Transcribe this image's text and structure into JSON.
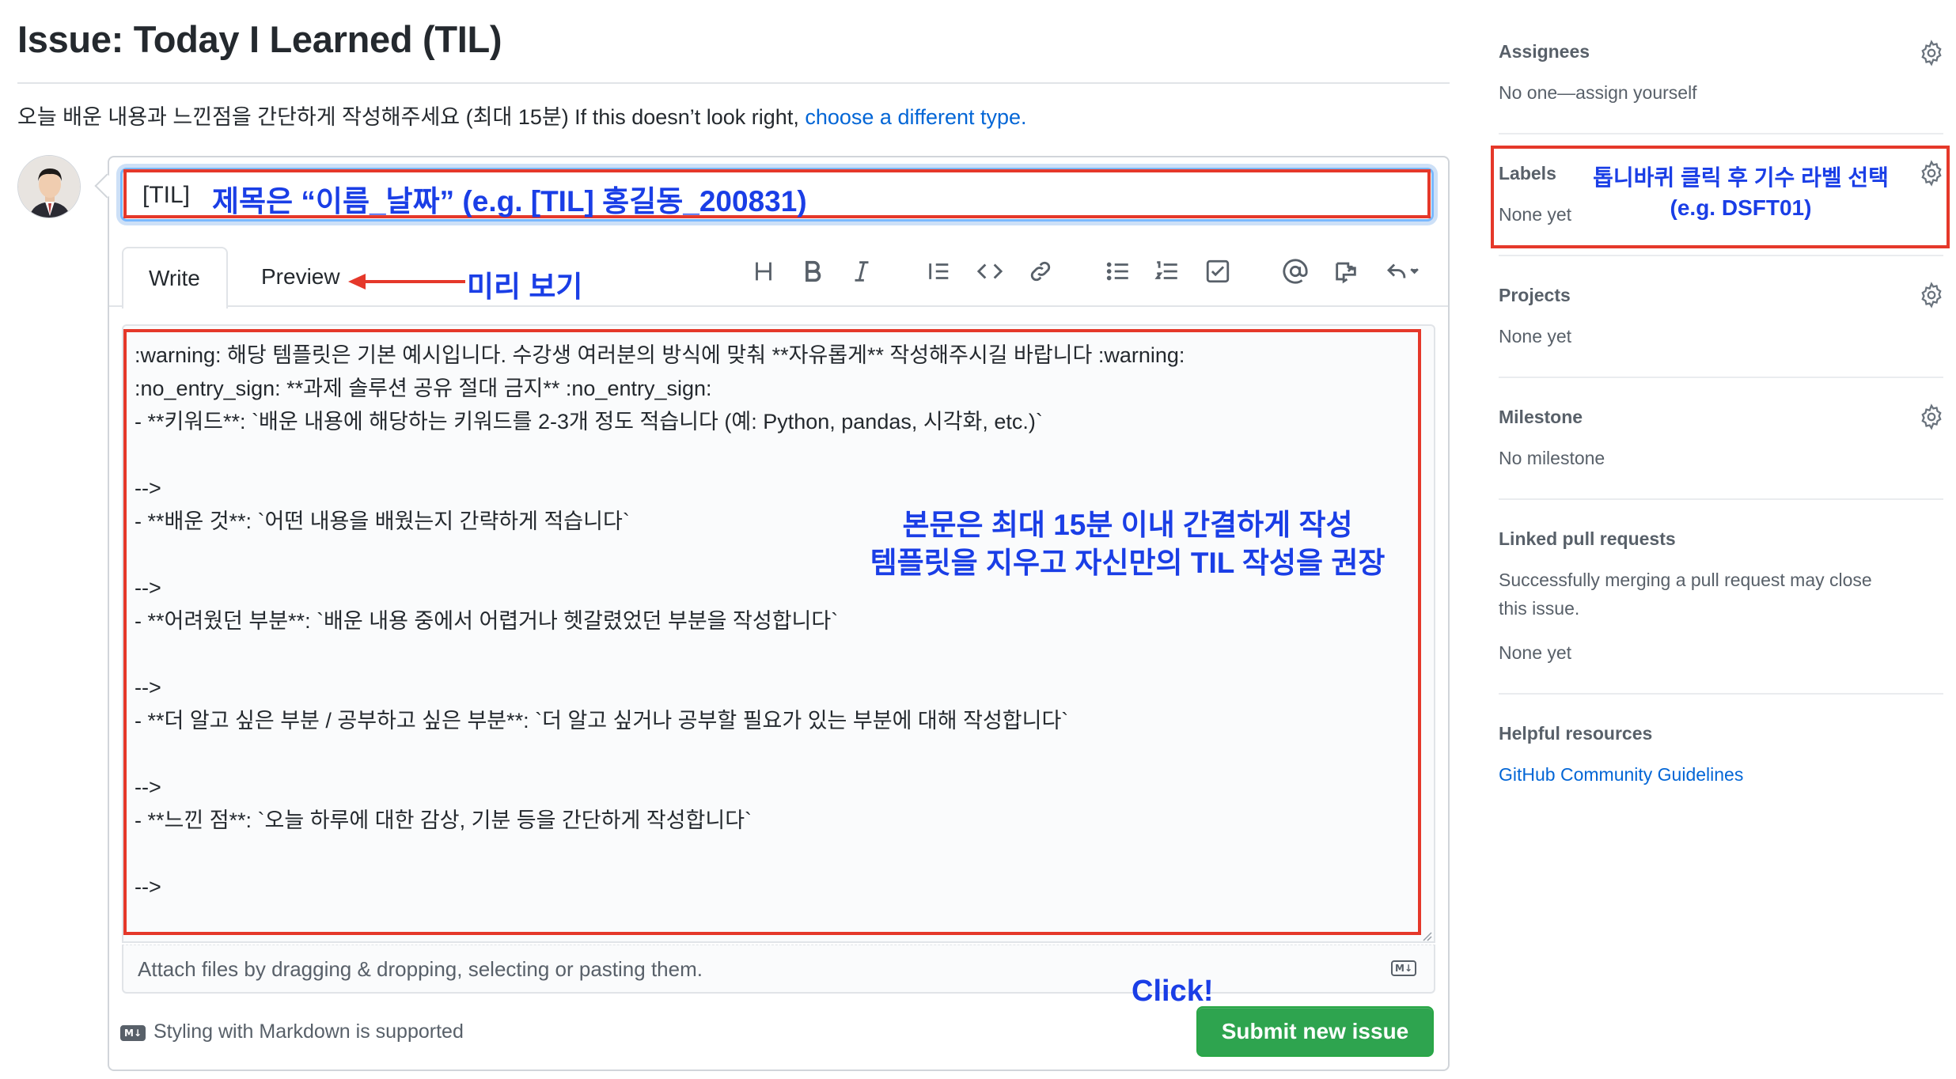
{
  "header": {
    "title": "Issue: Today I Learned (TIL)",
    "description": "오늘 배운 내용과 느낀점을 간단하게 작성해주세요 (최대 15분) If this doesn’t look right,",
    "change_type_link": "choose a different type."
  },
  "issue": {
    "title_value": "[TIL]"
  },
  "tabs": {
    "write": "Write",
    "preview": "Preview"
  },
  "toolbar": {
    "icons": [
      "heading-icon",
      "bold-icon",
      "italic-icon",
      "quote-icon",
      "code-icon",
      "link-icon",
      "unordered-list-icon",
      "ordered-list-icon",
      "task-list-icon",
      "mention-icon",
      "reference-icon",
      "reply-icon"
    ]
  },
  "body": {
    "lines": [
      ":warning: 해당 템플릿은 기본 예시입니다. 수강생 여러분의 방식에 맞춰 **자유롭게** 작성해주시길 바랍니다 :warning:",
      ":no_entry_sign: **과제 솔루션 공유 절대 금지** :no_entry_sign:",
      "- **키워드**: `배운 내용에 해당하는 키워드를 2-3개 정도 적습니다 (예: Python, pandas, 시각화, etc.)`",
      "",
      "-->",
      "- **배운 것**: `어떤 내용을 배웠는지 간략하게 적습니다`",
      "",
      "-->",
      "- **어려웠던 부분**: `배운 내용 중에서 어렵거나 헷갈렸었던 부분을 작성합니다`",
      "",
      "-->",
      "- **더 알고 싶은 부분 / 공부하고 싶은 부분**: `더 알고 싶거나 공부할 필요가 있는 부분에 대해 작성합니다`",
      "",
      "-->",
      "- **느낀 점**: `오늘 하루에 대한 감상, 기분 등을 간단하게 작성합니다`",
      "",
      "-->"
    ]
  },
  "attach": {
    "text": "Attach files by dragging & dropping, selecting or pasting them.",
    "md_badge": "M↓"
  },
  "footer": {
    "markdown_note": "Styling with Markdown is supported",
    "submit_label": "Submit new issue"
  },
  "annotations": {
    "title_hint": "제목은 “이름_날짜” (e.g. [TIL] 홍길동_200831)",
    "preview_hint": "미리 보기",
    "body_hint_1": "본문은 최대 15분 이내 간결하게 작성",
    "body_hint_2": "템플릿을 지우고 자신만의 TIL 작성을 권장",
    "click_hint": "Click!",
    "labels_hint_1": "톱니바퀴 클릭 후 기수 라벨 선택",
    "labels_hint_2": "(e.g. DSFT01)"
  },
  "sidebar": {
    "assignees": {
      "heading": "Assignees",
      "value": "No one—assign yourself"
    },
    "labels": {
      "heading": "Labels",
      "value": "None yet"
    },
    "projects": {
      "heading": "Projects",
      "value": "None yet"
    },
    "milestone": {
      "heading": "Milestone",
      "value": "No milestone"
    },
    "linked_prs": {
      "heading": "Linked pull requests",
      "description_1": "Successfully merging a pull request may close",
      "description_2": "this issue.",
      "value": "None yet"
    },
    "helpful": {
      "heading": "Helpful resources",
      "link": "GitHub Community Guidelines"
    }
  },
  "colors": {
    "accent_link": "#0366d6",
    "submit_green": "#2ea44f",
    "annotation_red": "#e5382a",
    "annotation_blue": "#1a3ee6"
  }
}
